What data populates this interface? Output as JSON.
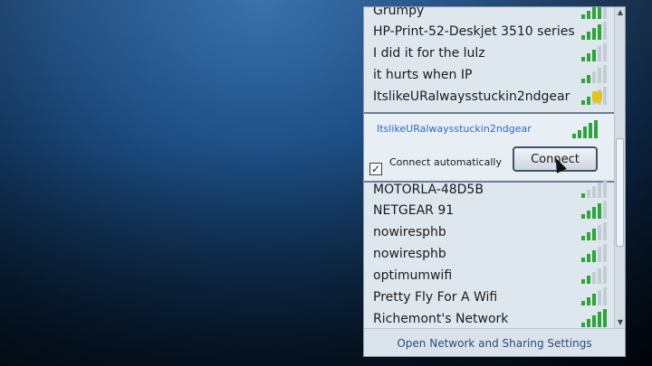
{
  "networks": [
    {
      "name": "Grumpy",
      "signal": 4
    },
    {
      "name": "HP-Print-52-Deskjet 3510 series",
      "signal": 4
    },
    {
      "name": "I did it for the lulz",
      "signal": 3
    },
    {
      "name": "it hurts when IP",
      "signal": 2
    },
    {
      "name": "ItslikeURalwaysstuckin2ndgear",
      "signal": 2,
      "secured_shield": true
    },
    {
      "name": "MOTORLA-48D5B",
      "signal": 1
    },
    {
      "name": "NETGEAR 91",
      "signal": 4
    },
    {
      "name": "nowiresphb",
      "signal": 3
    },
    {
      "name": "nowiresphb",
      "signal": 3
    },
    {
      "name": "optimumwifi",
      "signal": 2
    },
    {
      "name": "Pretty Fly For A Wifi",
      "signal": 3
    },
    {
      "name": "Richemont's Network",
      "signal": 5
    }
  ],
  "expanded": {
    "name": "ItslikeURalwaysstuckin2ndgear",
    "signal": 5,
    "connect_automatically_label": "Connect automatically",
    "connect_automatically_checked": true,
    "checkbox_glyph": "✓",
    "connect_button_label": "Connect"
  },
  "scrollbar": {
    "up_glyph": "▲",
    "down_glyph": "▼"
  },
  "footer": {
    "link_label": "Open Network and Sharing Settings"
  },
  "colors": {
    "signal_on": "#2ea43a",
    "signal_off": "#c3ccd4",
    "expanded_name": "#2f68c8"
  },
  "icons": {
    "signal": "wifi-signal-bars-icon",
    "shield": "security-shield-icon",
    "cursor": "mouse-pointer-icon"
  }
}
